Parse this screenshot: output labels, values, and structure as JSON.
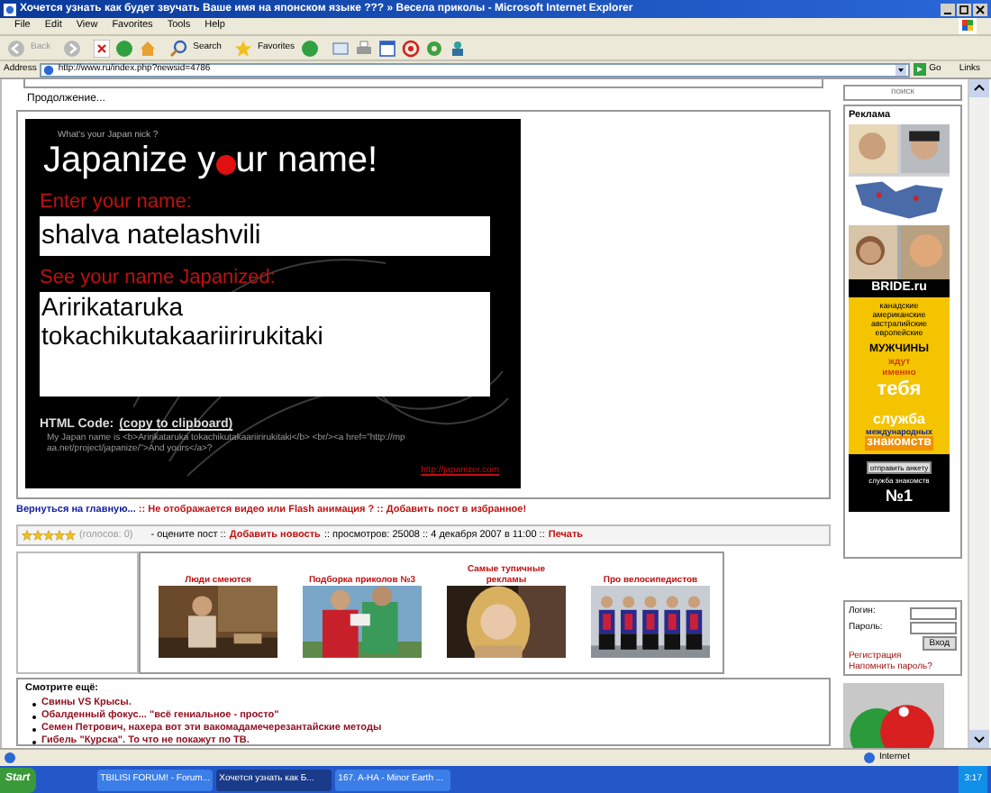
{
  "window": {
    "title": "Хочется узнать как будет звучать Ваше имя на японском языке ??? » Весела приколы - Microsoft Internet Explorer"
  },
  "menu": [
    "File",
    "Edit",
    "View",
    "Favorites",
    "Tools",
    "Help"
  ],
  "toolbar": {
    "back": "Back",
    "search": "Search",
    "favorites": "Favorites"
  },
  "address": {
    "label": "Address",
    "url": "http://www.ru/index.php?newsid=4786",
    "go": "Go",
    "links": "Links"
  },
  "page": {
    "continued": "Продолжение...",
    "flash": {
      "nick": "What's your Japan nick ?",
      "title_before": "Japanize y",
      "title_after": "ur name!",
      "enter_label": "Enter your name:",
      "name_value": "shalva natelashvili",
      "result_label": "See your name Japanized:",
      "result_value": "Aririkataruka tokachikutakaariirirukitaki",
      "html_label": "HTML Code:",
      "copy_link": "(copy to clipboard)",
      "code": "My Japan name is <b>Aririkataruka tokachikutakaariirirukitaki</b> <br/><a href=\"http://mpaa.net/project/japanize/\">And yours</a>?",
      "footer_link": "http://japanizer.com"
    },
    "nav": {
      "back_link": "Вернуться на главную...",
      "rest": " :: Не отображается видео или Flash анимация ? :: Добавить пост в избранное!"
    },
    "rating": {
      "stars": 5,
      "votes": "(голосов: 0)",
      "rate": "- оцените пост ::",
      "add_news": "Добавить новость",
      "views": ":: просмотров: 25008 :: 4 декабря 2007 в 11:00 ::",
      "print": "Печать"
    },
    "related": [
      {
        "title": "Люди смеются"
      },
      {
        "title": "Подборка приколов №3"
      },
      {
        "title": "Самые тупичные рекламы"
      },
      {
        "title": "Про велосипедистов"
      }
    ],
    "see_also": {
      "heading": "Смотрите ещё:",
      "items": [
        "Свины VS Крысы.",
        "Обалденный фокус... \"всё гениальное - просто\"",
        "Семен Петрович, нахера вот эти вакомадамечерезантайские методы",
        "Гибель \"Курска\". То что не покажут по TB."
      ]
    }
  },
  "sidebar": {
    "search_button": "поиск",
    "ads_heading": "Реклама",
    "banner": {
      "brand": "BRIDE.ru",
      "lines": [
        "канадские",
        "американские",
        "австралийские",
        "европейские"
      ],
      "men": "МУЖЧИНЫ",
      "wait": [
        "ждут",
        "именно"
      ],
      "you": "тебя",
      "service": "служба",
      "intl": "международных",
      "dating": "знакомств",
      "button": "отправить анкету",
      "footer": "служба знакомств",
      "number": "№1"
    },
    "login": {
      "login_label": "Логин:",
      "password_label": "Пароль:",
      "submit": "Вход",
      "register": "Регистрация",
      "remind": "Напомнить пароль?"
    }
  },
  "status_bar": {
    "zone": "Internet"
  },
  "taskbar": {
    "start": "Start",
    "tasks": [
      {
        "label": "TBILISI FORUM! - Forum...",
        "selected": false
      },
      {
        "label": "Хочется узнать как Б...",
        "selected": true
      },
      {
        "label": "167. A-HA - Minor Earth ...",
        "selected": false
      }
    ],
    "clock": "3:17"
  }
}
